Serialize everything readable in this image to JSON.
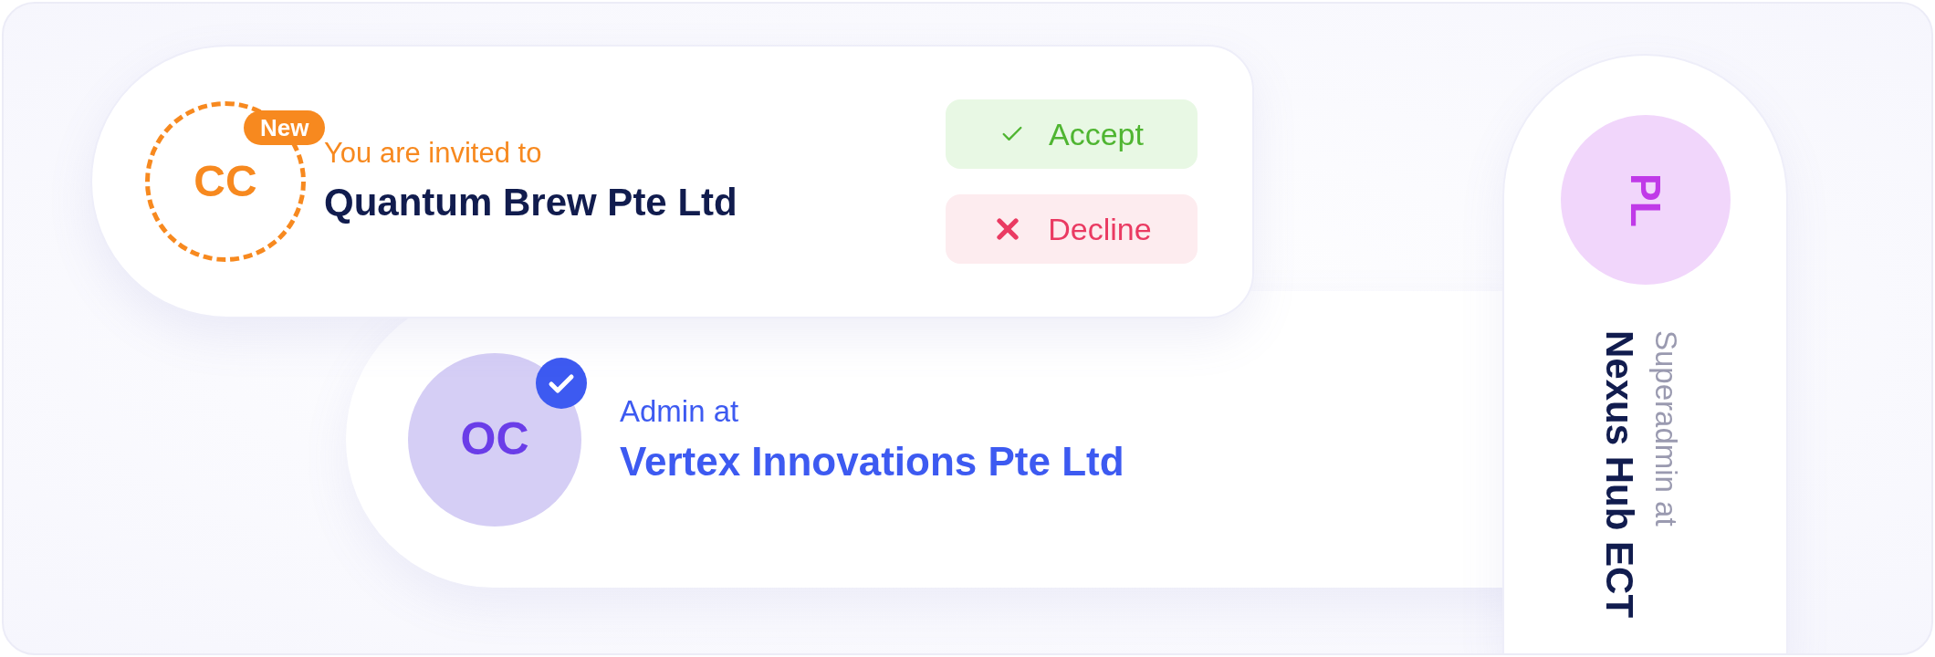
{
  "cards": [
    {
      "kind": "invite",
      "avatar": {
        "initials": "CC"
      },
      "badge": "New",
      "subtitle": "You are invited to",
      "title": "Quantum Brew Pte Ltd",
      "buttons": [
        {
          "kind": "accept",
          "label": "Accept"
        },
        {
          "kind": "decline",
          "label": "Decline"
        }
      ]
    },
    {
      "kind": "member",
      "avatar": {
        "initials": "OC"
      },
      "verified": true,
      "subtitle": "Admin at",
      "title": "Vertex Innovations Pte Ltd"
    },
    {
      "kind": "vertical",
      "avatar": {
        "initials": "PL"
      },
      "subtitle": "Superadmin at",
      "title": "Nexus Hub ECT"
    }
  ]
}
